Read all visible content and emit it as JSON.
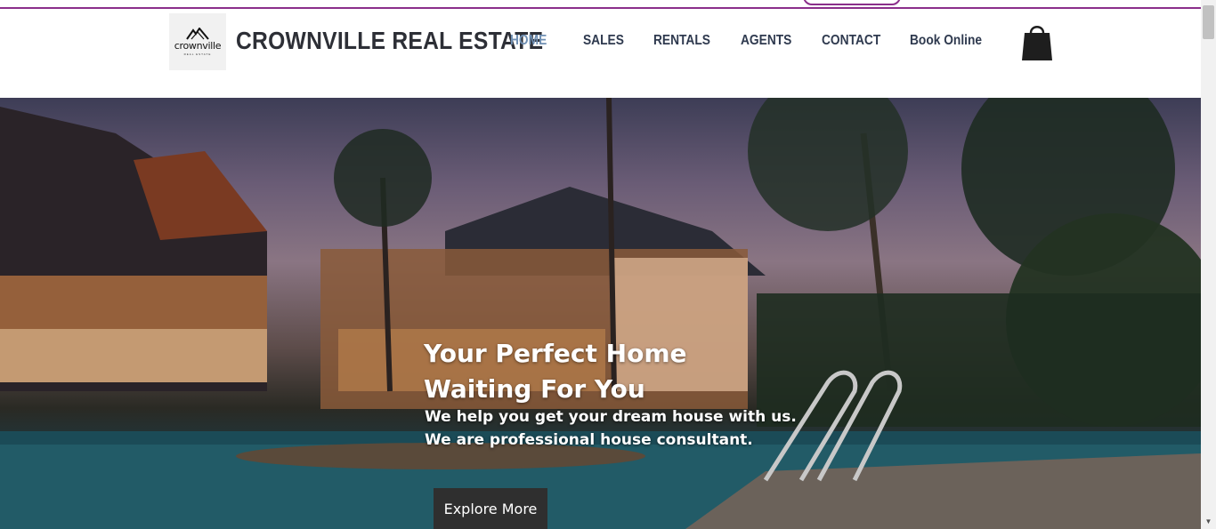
{
  "brand": {
    "logo_text": "crownville",
    "logo_subtext": "REAL ESTATE",
    "name": "CROWNVILLE REAL ESTATE"
  },
  "nav": {
    "items": [
      {
        "label": "HOME",
        "active": true
      },
      {
        "label": "SALES",
        "active": false
      },
      {
        "label": "RENTALS",
        "active": false
      },
      {
        "label": "AGENTS",
        "active": false
      },
      {
        "label": "CONTACT",
        "active": false
      },
      {
        "label": "Book Online",
        "active": false
      }
    ]
  },
  "cart": {
    "icon": "shopping-bag-icon"
  },
  "hero": {
    "title_line1": "Your Perfect Home",
    "title_line2": "Waiting For You",
    "subtitle_line1": "We help you get your dream house with us.",
    "subtitle_line2": "We are professional house consultant.",
    "cta_label": "Explore More"
  },
  "colors": {
    "accent_purple": "#8b2f8b",
    "nav_active": "#6f8fb3",
    "nav_text": "#2f3a4f",
    "brand_text": "#2d2f36",
    "cta_bg": "#2f2f2f"
  }
}
